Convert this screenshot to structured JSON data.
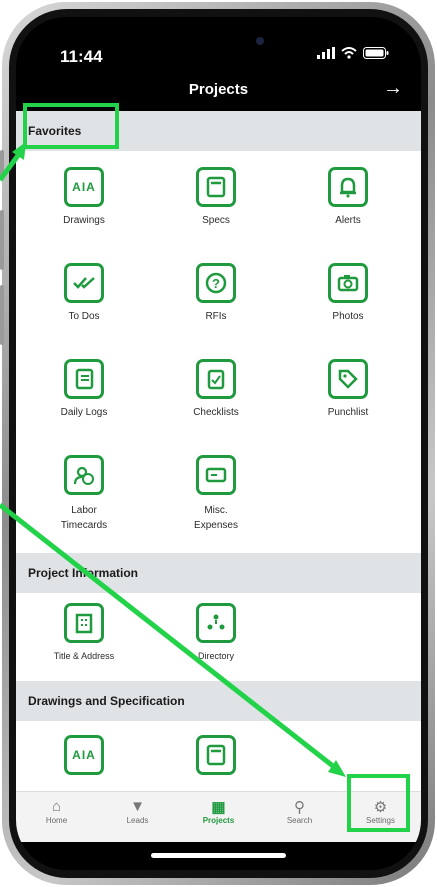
{
  "status": {
    "time": "11:44"
  },
  "header": {
    "title": "Projects",
    "arrow": "→"
  },
  "sections": [
    {
      "title": "Favorites"
    },
    {
      "title": "Project Information"
    },
    {
      "title": "Drawings and Specification"
    }
  ],
  "favorites": [
    {
      "label": "Drawings",
      "icon": "drawings-icon"
    },
    {
      "label": "Specs",
      "icon": "specs-icon"
    },
    {
      "label": "Alerts",
      "icon": "bell-icon"
    },
    {
      "label": "To Dos",
      "icon": "checkmarks-icon"
    },
    {
      "label": "RFIs",
      "icon": "question-icon"
    },
    {
      "label": "Photos",
      "icon": "camera-icon"
    },
    {
      "label": "Daily Logs",
      "icon": "notebook-icon"
    },
    {
      "label": "Checklists",
      "icon": "clipboard-icon"
    },
    {
      "label": "Punchlist",
      "icon": "tag-icon"
    },
    {
      "label": "Labor\nTimecards",
      "icon": "person-clock-icon"
    },
    {
      "label": "Misc.\nExpenses",
      "icon": "card-icon"
    }
  ],
  "project_info": [
    {
      "label": "Title & Address",
      "icon": "building-icon"
    },
    {
      "label": "Directory",
      "icon": "people-icon"
    }
  ],
  "tabs": [
    {
      "label": "Home",
      "icon": "home-icon"
    },
    {
      "label": "Leads",
      "icon": "filter-icon"
    },
    {
      "label": "Projects",
      "icon": "building-icon",
      "active": true
    },
    {
      "label": "Search",
      "icon": "search-icon"
    },
    {
      "label": "Settings",
      "icon": "gear-icon"
    }
  ],
  "colors": {
    "accent": "#1f9a3e",
    "highlight": "#22d34a",
    "section_bg": "#dfe3e6"
  }
}
